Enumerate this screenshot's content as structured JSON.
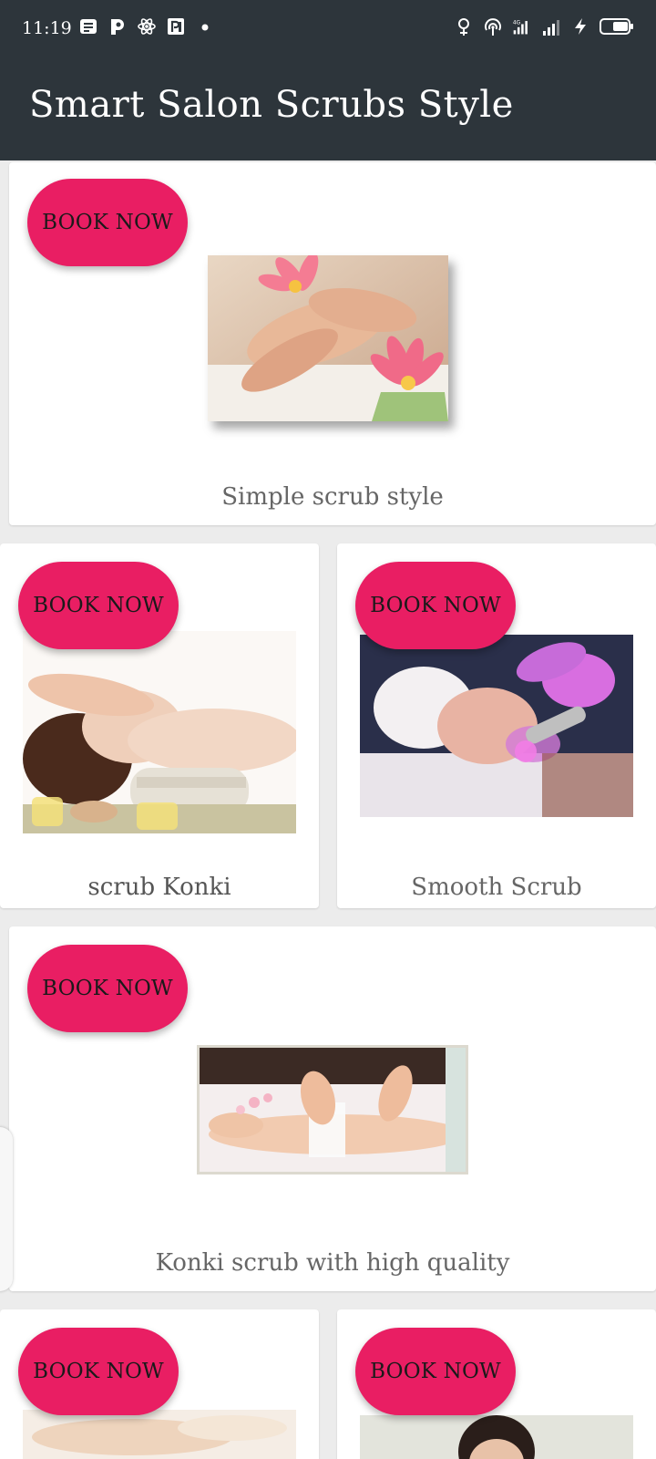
{
  "status_bar": {
    "time": "11:19",
    "left_icons": [
      "notes-icon",
      "paytm-icon",
      "react-icon",
      "parking-icon",
      "dot-icon"
    ],
    "right_icons": [
      "location-icon",
      "hotspot-icon",
      "signal-icon",
      "signal-icon",
      "charging-icon",
      "battery-icon"
    ]
  },
  "app_bar": {
    "title": "Smart Salon Scrubs Style"
  },
  "cards": [
    {
      "button_label": "BOOK NOW",
      "title": "Simple scrub style",
      "image": "foot-massage-lotus-image"
    },
    {
      "button_label": "BOOK NOW",
      "title": "scrub Konki",
      "image": "face-massage-towels-image"
    },
    {
      "button_label": "BOOK NOW",
      "title": "Smooth Scrub",
      "image": "facial-light-therapy-image"
    },
    {
      "button_label": "BOOK NOW",
      "title": "Konki scrub with high quality",
      "image": "leg-wax-image"
    },
    {
      "button_label": "BOOK NOW",
      "title": "",
      "image": "back-scrub-image"
    },
    {
      "button_label": "BOOK NOW",
      "title": "",
      "image": "woman-portrait-image"
    }
  ],
  "colors": {
    "app_bar_bg": "#2d353b",
    "accent": "#e91e63",
    "page_bg": "#ececec",
    "label_text": "#666666"
  }
}
